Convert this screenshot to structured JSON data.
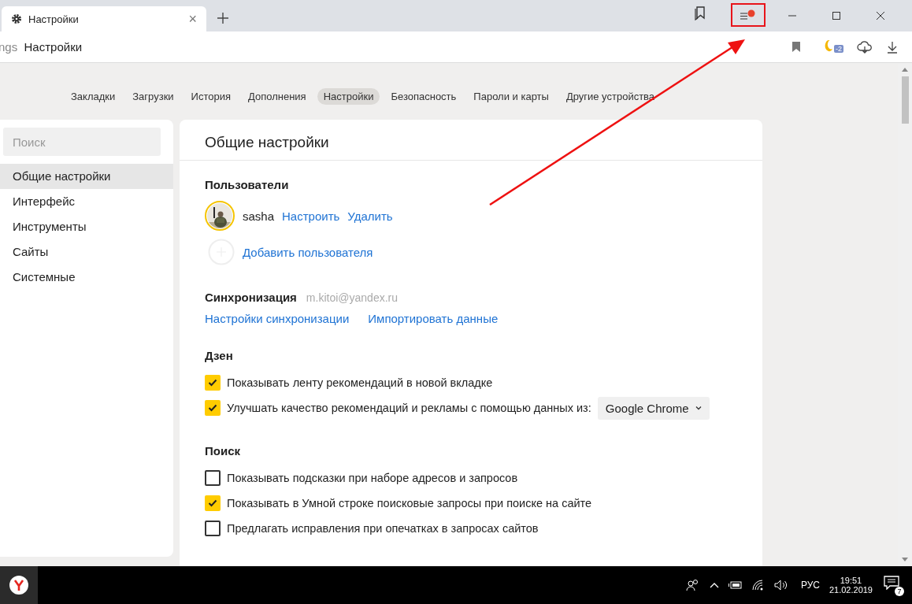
{
  "tabs": [
    {
      "title": "Настройки",
      "close": "×",
      "selected": true
    }
  ],
  "address": {
    "prefix": "ngs",
    "title": "Настройки"
  },
  "extension_badge": "-2",
  "menu_notification": true,
  "nav": [
    {
      "label": "Закладки",
      "selected": false
    },
    {
      "label": "Загрузки",
      "selected": false
    },
    {
      "label": "История",
      "selected": false
    },
    {
      "label": "Дополнения",
      "selected": false
    },
    {
      "label": "Настройки",
      "selected": true
    },
    {
      "label": "Безопасность",
      "selected": false
    },
    {
      "label": "Пароли и карты",
      "selected": false
    },
    {
      "label": "Другие устройства",
      "selected": false
    }
  ],
  "sidebar": {
    "search": {
      "placeholder": "Поиск"
    },
    "items": [
      {
        "label": "Общие настройки",
        "selected": true
      },
      {
        "label": "Интерфейс",
        "selected": false
      },
      {
        "label": "Инструменты",
        "selected": false
      },
      {
        "label": "Сайты",
        "selected": false
      },
      {
        "label": "Системные",
        "selected": false
      }
    ]
  },
  "content": {
    "title": "Общие настройки",
    "users": {
      "heading": "Пользователи",
      "name": "sasha",
      "links": [
        "Настроить",
        "Удалить"
      ],
      "add": "Добавить пользователя"
    },
    "sync": {
      "heading": "Синхронизация",
      "email": "m.kitoi@yandex.ru",
      "links": [
        "Настройки синхронизации",
        "Импортировать данные"
      ]
    },
    "zen": {
      "heading": "Дзен",
      "options": [
        {
          "label": "Показывать ленту рекомендаций в новой вкладке",
          "checked": true
        },
        {
          "label": "Улучшать качество рекомендаций и рекламы с помощью данных из:",
          "checked": true,
          "select": "Google Chrome"
        }
      ]
    },
    "search": {
      "heading": "Поиск",
      "options": [
        {
          "label": "Показывать подсказки при наборе адресов и запросов",
          "checked": false
        },
        {
          "label": "Показывать в Умной строке поисковые запросы при поиске на сайте",
          "checked": true
        },
        {
          "label": "Предлагать исправления при опечатках в запросах сайтов",
          "checked": false
        }
      ]
    }
  },
  "taskbar": {
    "language": "РУС",
    "time": "19:51",
    "date": "21.02.2019",
    "notifications": "7"
  }
}
